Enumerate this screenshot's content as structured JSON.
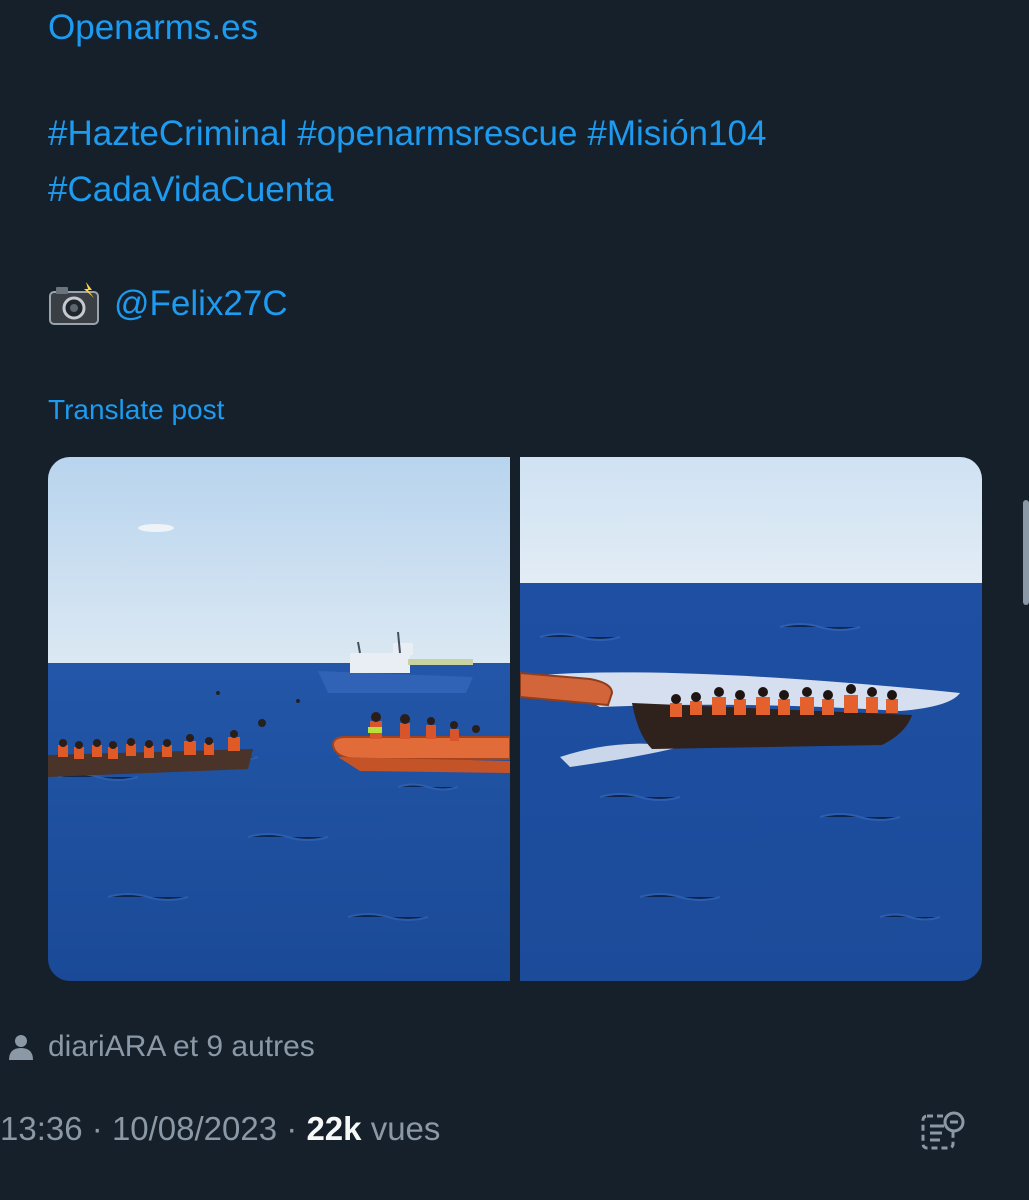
{
  "post": {
    "link_text": "Openarms.es",
    "hashtags_row1": [
      "#HazteCriminal",
      "#openarmsrescue",
      "#Misión104"
    ],
    "hashtags_row2": [
      "#CadaVidaCuenta"
    ],
    "photo_credit_emoji": "camera-flash-icon",
    "photo_credit_handle": "@Felix27C",
    "translate_label": "Translate post"
  },
  "media": {
    "photos": [
      {
        "icon": "photo-rescue-boats"
      },
      {
        "icon": "photo-wooden-boat"
      }
    ]
  },
  "reposts": {
    "text": "diariARA et 9 autres"
  },
  "meta": {
    "time": "13:36",
    "separator": "·",
    "date": "10/08/2023",
    "views_count": "22k",
    "views_label": "vues"
  },
  "colors": {
    "background": "#15202b",
    "link": "#1d9bf0",
    "muted": "#8b98a5",
    "text": "#f7f9f9"
  }
}
